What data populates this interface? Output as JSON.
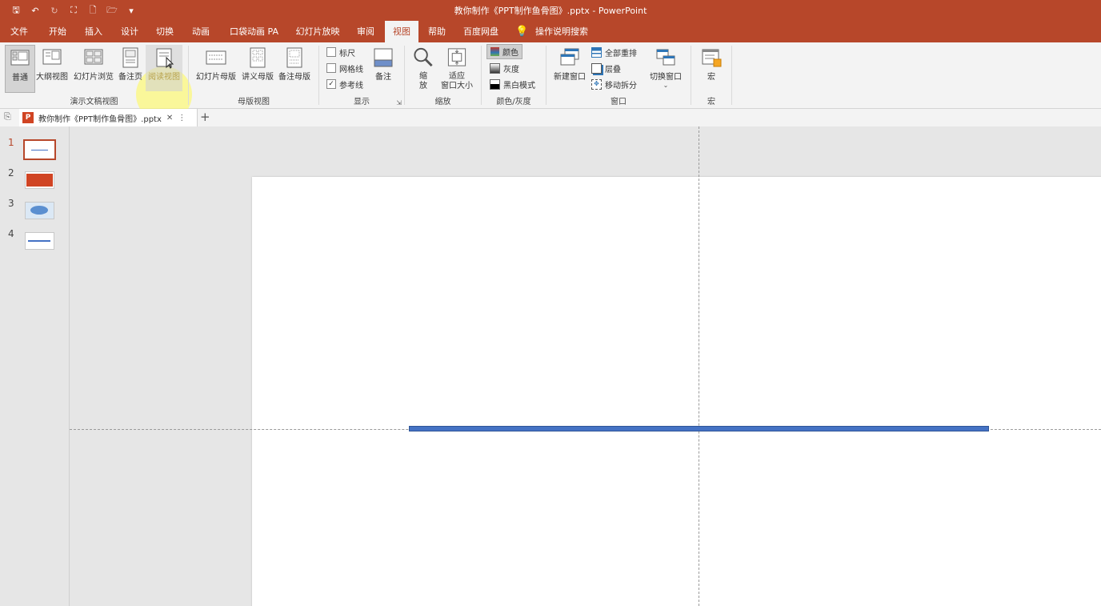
{
  "window": {
    "title": "教你制作《PPT制作鱼骨图》.pptx  -  PowerPoint"
  },
  "qat": [
    {
      "icon": "save-icon",
      "glyph": "🖫"
    },
    {
      "icon": "undo-icon",
      "glyph": "↶"
    },
    {
      "icon": "redo-icon",
      "glyph": "↻"
    },
    {
      "icon": "present-icon",
      "glyph": "⛶"
    },
    {
      "icon": "new-file-icon",
      "glyph": "🗋"
    },
    {
      "icon": "open-folder-icon",
      "glyph": "🗁"
    },
    {
      "icon": "customize-icon",
      "glyph": "▾"
    }
  ],
  "tabs": [
    "文件",
    "开始",
    "插入",
    "设计",
    "切换",
    "动画",
    "口袋动画 PA",
    "幻灯片放映",
    "审阅",
    "视图",
    "帮助",
    "百度网盘",
    "操作说明搜索"
  ],
  "active_tab": "视图",
  "ribbon": {
    "presentation_views": {
      "label": "演示文稿视图",
      "buttons": [
        "普通",
        "大纲视图",
        "幻灯片浏览",
        "备注页",
        "阅读视图"
      ]
    },
    "master_views": {
      "label": "母版视图",
      "buttons": [
        "幻灯片母版",
        "讲义母版",
        "备注母版"
      ]
    },
    "show": {
      "label": "显示",
      "checkboxes": [
        {
          "label": "标尺",
          "checked": false
        },
        {
          "label": "网格线",
          "checked": false
        },
        {
          "label": "参考线",
          "checked": true
        }
      ],
      "notes_button": "备注"
    },
    "zoom": {
      "label": "缩放",
      "zoom_button": "缩\n放",
      "fit_button": "适应\n窗口大小"
    },
    "color": {
      "label": "颜色/灰度",
      "options": [
        "颜色",
        "灰度",
        "黑白模式"
      ],
      "selected": "颜色"
    },
    "window": {
      "label": "窗口",
      "new_window": "新建窗口",
      "small": [
        "全部重排",
        "层叠",
        "移动拆分"
      ],
      "switch_window": "切换窗口"
    },
    "macros": {
      "label": "宏",
      "button": "宏"
    }
  },
  "doc_tab": {
    "name": "教你制作《PPT制作鱼骨图》.pptx",
    "close": "✕",
    "menu": "⋮",
    "add": "+"
  },
  "slides": [
    "1",
    "2",
    "3",
    "4"
  ],
  "colors": {
    "brand": "#b7472a",
    "line": "#4472c4"
  }
}
